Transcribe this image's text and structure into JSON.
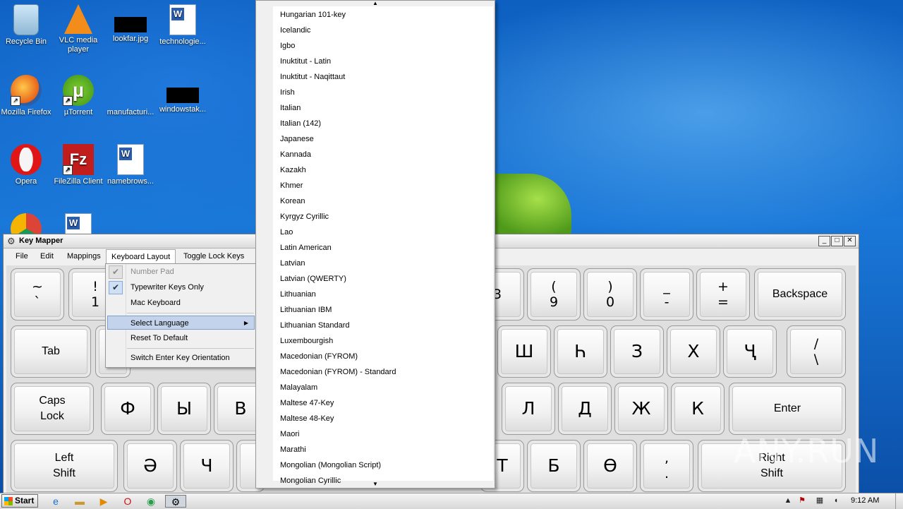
{
  "desktop": {
    "icons": [
      {
        "label": "Recycle Bin",
        "icon": "recycle-bin-icon"
      },
      {
        "label": "VLC media player",
        "icon": "vlc-icon"
      },
      {
        "label": "lookfar.jpg",
        "icon": "image-file-icon"
      },
      {
        "label": "technologie...",
        "icon": "word-document-icon"
      },
      {
        "label": "Mozilla Firefox",
        "icon": "firefox-icon"
      },
      {
        "label": "µTorrent",
        "icon": "utorrent-icon"
      },
      {
        "label": "manufacturi...",
        "icon": "file-icon"
      },
      {
        "label": "windowstak...",
        "icon": "image-file-icon"
      },
      {
        "label": "Opera",
        "icon": "opera-icon"
      },
      {
        "label": "FileZilla Client",
        "icon": "filezilla-icon"
      },
      {
        "label": "namebrows...",
        "icon": "word-document-icon"
      }
    ]
  },
  "window": {
    "title": "Key Mapper",
    "controls": {
      "minimize": "_",
      "maximize": "□",
      "close": "✕"
    }
  },
  "menubar": {
    "items": [
      "File",
      "Edit",
      "Mappings",
      "Keyboard Layout",
      "Toggle Lock Keys"
    ],
    "active": "Keyboard Layout"
  },
  "keyboard_layout_menu": {
    "items": [
      {
        "label": "Number Pad",
        "checked": true,
        "disabled": true
      },
      {
        "label": "Typewriter Keys Only",
        "checked": true,
        "disabled": false
      },
      {
        "label": "Mac Keyboard",
        "checked": false,
        "disabled": false
      },
      {
        "label": "Select Language",
        "submenu": true,
        "highlighted": true
      },
      {
        "label": "Reset To Default"
      },
      {
        "label": "Switch Enter Key Orientation"
      }
    ],
    "check_glyph": "✔",
    "submenu_glyph": "▶"
  },
  "language_menu": {
    "scroll_up": "▲",
    "scroll_down": "▼",
    "items": [
      "Hungarian 101-key",
      "Icelandic",
      "Igbo",
      "Inuktitut - Latin",
      "Inuktitut - Naqittaut",
      "Irish",
      "Italian",
      "Italian (142)",
      "Japanese",
      "Kannada",
      "Kazakh",
      "Khmer",
      "Korean",
      "Kyrgyz Cyrillic",
      "Lao",
      "Latin American",
      "Latvian",
      "Latvian (QWERTY)",
      "Lithuanian",
      "Lithuanian IBM",
      "Lithuanian Standard",
      "Luxembourgish",
      "Macedonian (FYROM)",
      "Macedonian (FYROM) - Standard",
      "Malayalam",
      "Maltese 47-Key",
      "Maltese 48-Key",
      "Maori",
      "Marathi",
      "Mongolian (Mongolian Script)",
      "Mongolian Cyrillic"
    ]
  },
  "keys": {
    "tilde": {
      "top": "~",
      "bottom": "`"
    },
    "excl": {
      "top": "!",
      "bottom": "1"
    },
    "k3": {
      "top": "",
      "bottom": "3"
    },
    "lparen": {
      "top": "(",
      "bottom": "9"
    },
    "rparen": {
      "top": ")",
      "bottom": "0"
    },
    "minus": {
      "top": "_",
      "bottom": "-"
    },
    "plus": {
      "top": "+",
      "bottom": "="
    },
    "backspace": "Backspace",
    "tab": "Tab",
    "sha": "Ш",
    "hbar": "Һ",
    "ze": "З",
    "ha": "Х",
    "che_desc": "Ҷ",
    "slash": {
      "top": "/",
      "bottom": "\\"
    },
    "caps": "Caps Lock",
    "ef": "Ф",
    "yeru": "Ы",
    "ve": "В",
    "el": "Л",
    "de": "Д",
    "zhe": "Ж",
    "ka": "К",
    "enter": "Enter",
    "lshift": "Left Shift",
    "schwa": "Ә",
    "che": "Ч",
    "te": "Т",
    "be": "Б",
    "obar": "Ө",
    "comma": {
      "top": ",",
      "bottom": "."
    },
    "rshift": "Right Shift"
  },
  "taskbar": {
    "start_label": "Start",
    "clock": "9:12 AM"
  },
  "watermark": "ANY.RUN"
}
